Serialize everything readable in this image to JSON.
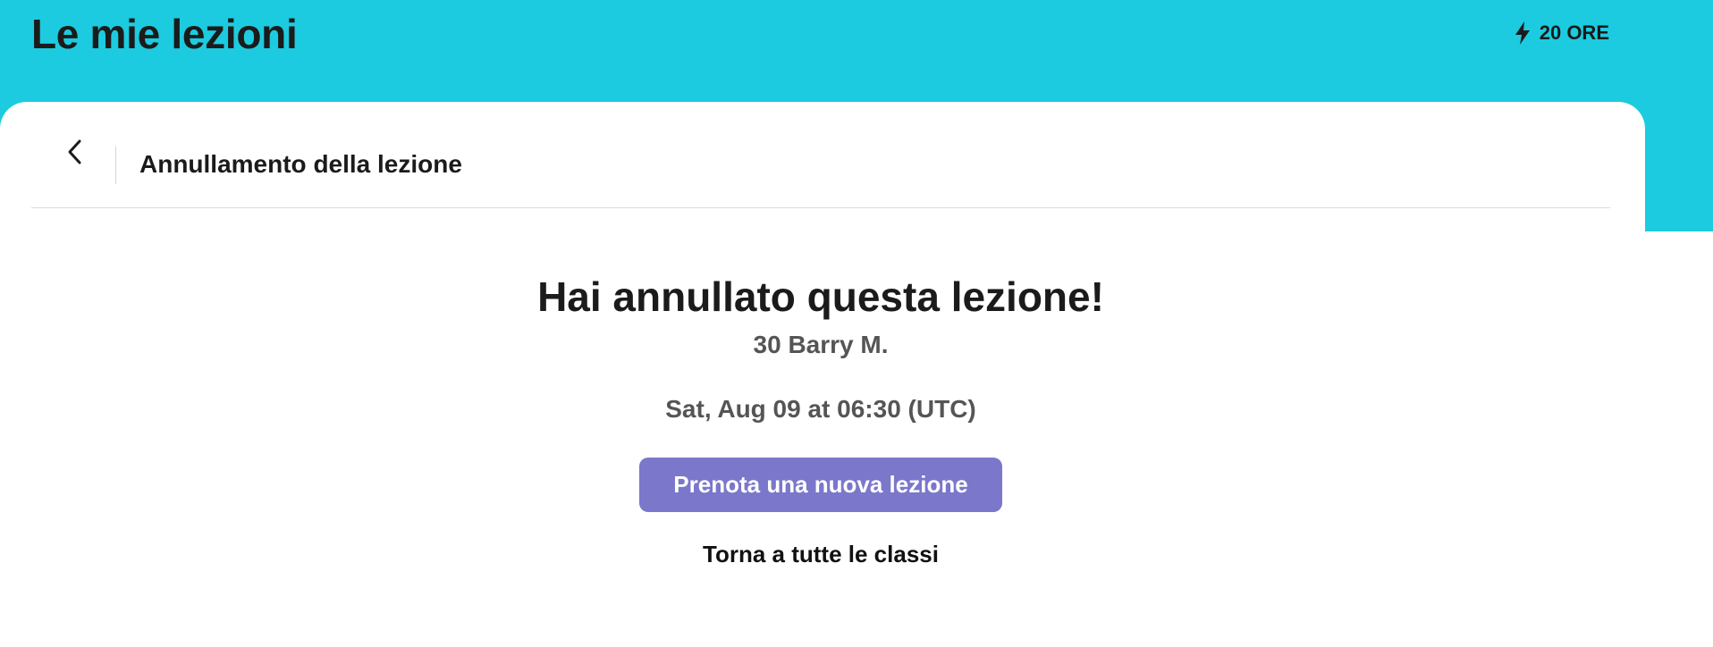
{
  "header": {
    "title": "Le mie lezioni",
    "hours_label": "20 ORE",
    "hours_icon": "lightning-bolt-icon"
  },
  "card": {
    "back_icon": "chevron-left-icon",
    "title": "Annullamento della lezione"
  },
  "confirmation": {
    "headline": "Hai annullato questa lezione!",
    "teacher": "30 Barry M.",
    "datetime": "Sat, Aug 09 at 06:30 (UTC)",
    "primary_button": "Prenota una nuova lezione",
    "secondary_link": "Torna a tutte le classi"
  },
  "colors": {
    "top_band": "#1ccbdf",
    "primary_button": "#7b77cb",
    "text_dark": "#1b1b1b",
    "text_muted": "#555555"
  }
}
